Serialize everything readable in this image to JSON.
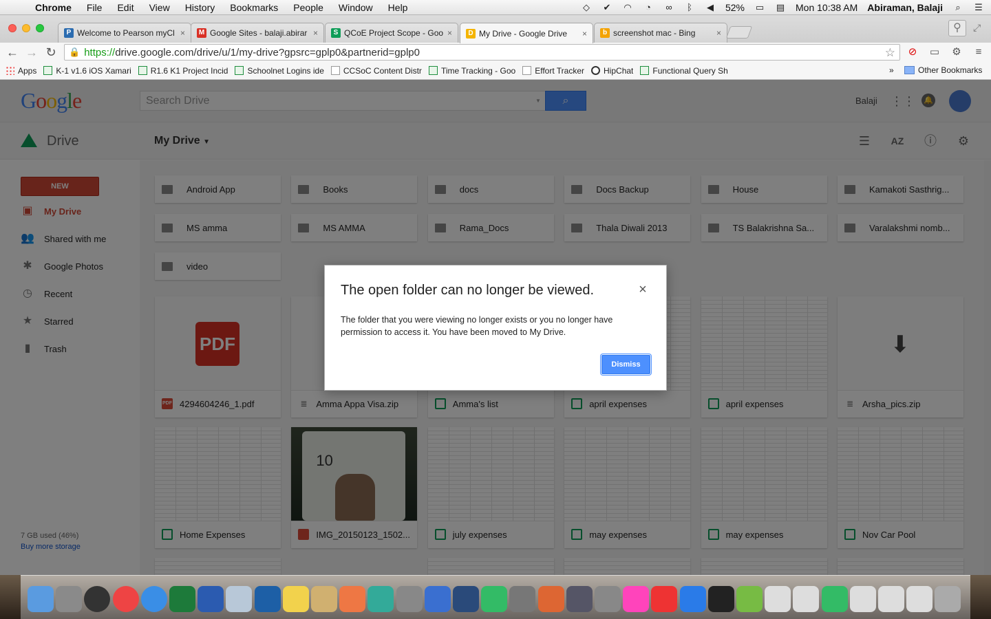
{
  "menubar": {
    "app": "Chrome",
    "items": [
      "File",
      "Edit",
      "View",
      "History",
      "Bookmarks",
      "People",
      "Window",
      "Help"
    ],
    "battery": "52%",
    "clock": "Mon 10:38 AM",
    "user": "Abiraman, Balaji"
  },
  "tabs": [
    {
      "title": "Welcome to Pearson myCl",
      "color": "#2b6cb0",
      "glyph": "P"
    },
    {
      "title": "Google Sites - balaji.abirar",
      "color": "#d93025",
      "glyph": "M"
    },
    {
      "title": "QCoE Project Scope - Goog",
      "color": "#0f9d58",
      "glyph": "S"
    },
    {
      "title": "My Drive - Google Drive",
      "color": "#f4b400",
      "glyph": "D"
    },
    {
      "title": "screenshot mac - Bing",
      "color": "#f4a300",
      "glyph": "b"
    }
  ],
  "url": {
    "scheme": "https://",
    "rest": "drive.google.com/drive/u/1/my-drive?gpsrc=gplp0&partnerid=gplp0"
  },
  "bookmarks": [
    {
      "label": "Apps",
      "kind": "apps"
    },
    {
      "label": "K-1 v1.6 iOS Xamari",
      "kind": "sheet"
    },
    {
      "label": "R1.6 K1 Project Incid",
      "kind": "sheet"
    },
    {
      "label": "Schoolnet Logins ide",
      "kind": "sheet"
    },
    {
      "label": "CCSoC Content Distr",
      "kind": "page"
    },
    {
      "label": "Time Tracking - Goo",
      "kind": "sheet"
    },
    {
      "label": "Effort Tracker",
      "kind": "page"
    },
    {
      "label": "HipChat",
      "kind": "chat"
    },
    {
      "label": "Functional Query Sh",
      "kind": "sheet"
    }
  ],
  "bookmarks_more": "»",
  "other_bookmarks": "Other Bookmarks",
  "drive": {
    "logo": "Google",
    "search_placeholder": "Search Drive",
    "user_name": "Balaji",
    "product": "Drive",
    "title": "My Drive",
    "new_label": "NEW",
    "nav": [
      {
        "label": "My Drive",
        "icon": "drive-folder-icon",
        "glyph": "▣",
        "active": true
      },
      {
        "label": "Shared with me",
        "icon": "people-icon",
        "glyph": "👥",
        "active": false
      },
      {
        "label": "Google Photos",
        "icon": "photos-icon",
        "glyph": "✱",
        "active": false
      },
      {
        "label": "Recent",
        "icon": "clock-icon",
        "glyph": "◷",
        "active": false
      },
      {
        "label": "Starred",
        "icon": "star-icon",
        "glyph": "★",
        "active": false
      },
      {
        "label": "Trash",
        "icon": "trash-icon",
        "glyph": "▮",
        "active": false
      }
    ],
    "storage": "7 GB used (46%)",
    "buy_more": "Buy more storage",
    "folders": [
      {
        "name": "Android App",
        "shared": false
      },
      {
        "name": "Books",
        "shared": false
      },
      {
        "name": "docs",
        "shared": false
      },
      {
        "name": "Docs Backup",
        "shared": false
      },
      {
        "name": "House",
        "shared": false
      },
      {
        "name": "Kamakoti Sasthrig...",
        "shared": false
      },
      {
        "name": "MS amma",
        "shared": false
      },
      {
        "name": "MS AMMA",
        "shared": false
      },
      {
        "name": "Rama_Docs",
        "shared": false
      },
      {
        "name": "Thala Diwali 2013",
        "shared": false
      },
      {
        "name": "TS Balakrishna Sa...",
        "shared": false
      },
      {
        "name": "Varalakshmi nomb...",
        "shared": true
      },
      {
        "name": "video",
        "shared": false
      }
    ],
    "files": [
      {
        "name": "4294604246_1.pdf",
        "type": "pdf",
        "thumb": "pdf"
      },
      {
        "name": "Amma Appa Visa.zip",
        "type": "zip",
        "thumb": "blank"
      },
      {
        "name": "Amma's list",
        "type": "sheet",
        "thumb": "sheet"
      },
      {
        "name": "april expenses",
        "type": "sheet",
        "thumb": "sheet"
      },
      {
        "name": "april expenses",
        "type": "sheet",
        "thumb": "sheet"
      },
      {
        "name": "Arsha_pics.zip",
        "type": "zip",
        "thumb": "zip"
      },
      {
        "name": "Home Expenses",
        "type": "sheet",
        "thumb": "sheet"
      },
      {
        "name": "IMG_20150123_1502...",
        "type": "img",
        "thumb": "photo"
      },
      {
        "name": "july expenses",
        "type": "sheet",
        "thumb": "sheet"
      },
      {
        "name": "may expenses",
        "type": "sheet",
        "thumb": "sheet"
      },
      {
        "name": "may expenses",
        "type": "sheet",
        "thumb": "sheet"
      },
      {
        "name": "Nov Car Pool",
        "type": "sheet",
        "thumb": "sheet"
      }
    ],
    "pdf_badge": "PDF",
    "photo_number": "10"
  },
  "dialog": {
    "title": "The open folder can no longer be viewed.",
    "body": "The folder that you were viewing no longer exists or you no longer have permission to access it. You have been moved to My Drive.",
    "dismiss": "Dismiss",
    "close": "×"
  },
  "colors": {
    "accent": "#4d90fe",
    "new_button": "#d14836",
    "sheet_green": "#0f9d58"
  }
}
